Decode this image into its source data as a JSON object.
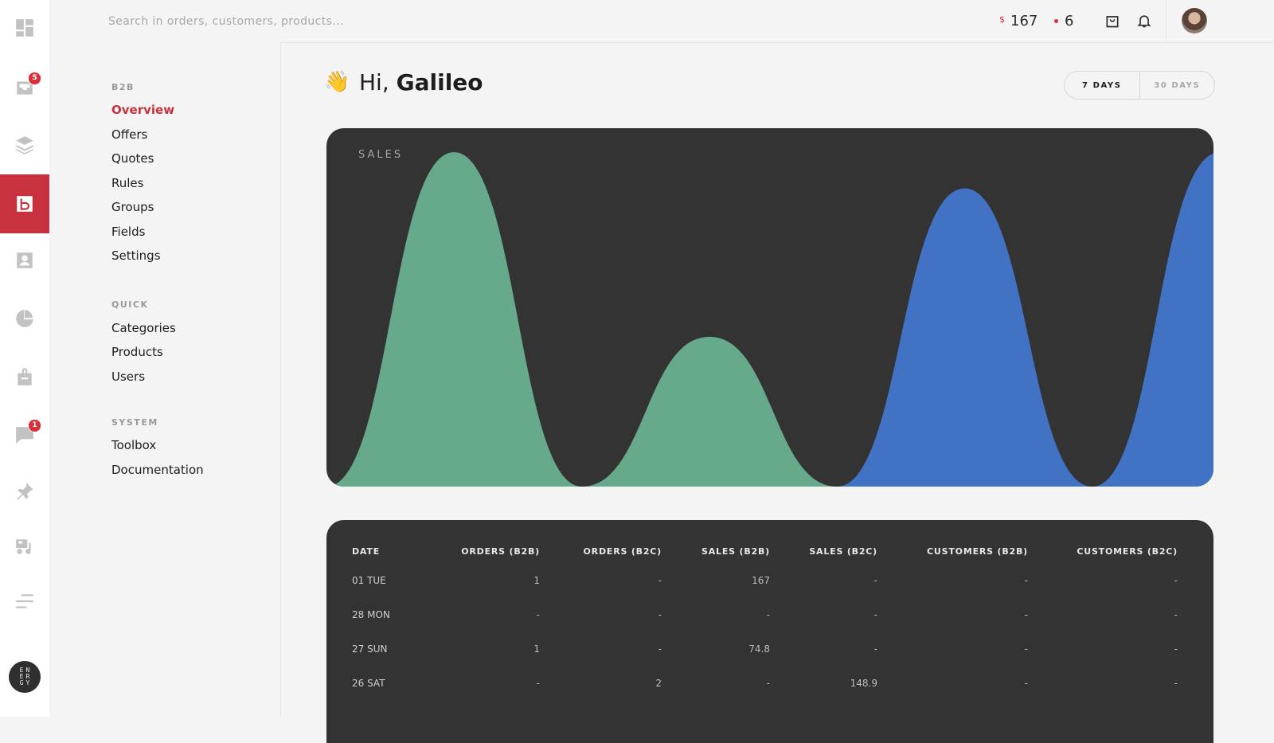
{
  "topbar": {
    "search_placeholder": "Search in orders, customers, products...",
    "revenue_currency": "$",
    "revenue_value": "167",
    "orders_value": "6"
  },
  "rail": {
    "orders_badge": "5",
    "messages_badge": "1",
    "logo_text": "ENERGY",
    "colors": {
      "active": "#c8323f",
      "badge": "#d9303c"
    }
  },
  "subnav": {
    "b2b_heading": "B2B",
    "b2b_items": [
      "Overview",
      "Offers",
      "Quotes",
      "Rules",
      "Groups",
      "Fields",
      "Settings"
    ],
    "quick_heading": "QUICK",
    "quick_items": [
      "Categories",
      "Products",
      "Users"
    ],
    "system_heading": "SYSTEM",
    "system_items": [
      "Toolbox",
      "Documentation"
    ]
  },
  "main": {
    "greeting_emoji": "👋",
    "greeting_prefix": "Hi,",
    "greeting_name": "Galileo",
    "range_options": [
      "7 DAYS",
      "30 DAYS"
    ],
    "selected_range": "7 DAYS"
  },
  "chart_data": {
    "type": "area",
    "title": "SALES",
    "series": [
      {
        "color": "#67a98b",
        "values": [
          0,
          167,
          0,
          74.8,
          0,
          0,
          0,
          0
        ]
      },
      {
        "color": "#4479d4",
        "values": [
          0,
          0,
          0,
          0,
          0,
          148.9,
          0,
          167
        ]
      }
    ],
    "ylim": [
      0,
      175
    ],
    "grid": false
  },
  "table": {
    "headers": [
      "DATE",
      "ORDERS (B2B)",
      "ORDERS (B2C)",
      "SALES (B2B)",
      "SALES (B2C)",
      "CUSTOMERS (B2B)",
      "CUSTOMERS (B2C)"
    ],
    "rows": [
      [
        "01 TUE",
        "1",
        "-",
        "167",
        "-",
        "-",
        "-"
      ],
      [
        "28 MON",
        "-",
        "-",
        "-",
        "-",
        "-",
        "-"
      ],
      [
        "27 SUN",
        "1",
        "-",
        "74.8",
        "-",
        "-",
        "-"
      ],
      [
        "26 SAT",
        "-",
        "2",
        "-",
        "148.9",
        "-",
        "-"
      ]
    ]
  }
}
